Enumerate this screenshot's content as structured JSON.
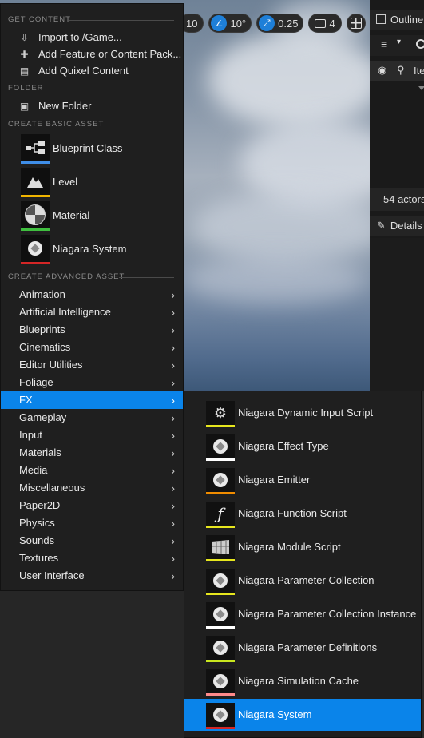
{
  "viewport_toolbar": {
    "grid_value": "10",
    "angle_value": "10°",
    "scale_value": "0.25",
    "camera_value": "4"
  },
  "outliner": {
    "title": "Outliner",
    "column_label": "Ite",
    "actors_count": "54 actors",
    "details_title": "Details"
  },
  "menu": {
    "get_content": {
      "header": "GET CONTENT",
      "items": [
        {
          "label": "Import to /Game...",
          "icon": "import-icon"
        },
        {
          "label": "Add Feature or Content Pack...",
          "icon": "add-feature-icon"
        },
        {
          "label": "Add Quixel Content",
          "icon": "quixel-icon"
        }
      ]
    },
    "folder": {
      "header": "FOLDER",
      "items": [
        {
          "label": "New Folder",
          "icon": "new-folder-icon"
        }
      ]
    },
    "basic_assets": {
      "header": "CREATE BASIC ASSET",
      "items": [
        {
          "label": "Blueprint Class",
          "color": "#3f8ee8",
          "icon": "blueprint-class-icon"
        },
        {
          "label": "Level",
          "color": "#f0b400",
          "icon": "level-icon"
        },
        {
          "label": "Material",
          "color": "#3fbf3f",
          "icon": "material-icon"
        },
        {
          "label": "Niagara System",
          "color": "#d42626",
          "icon": "niagara-system-icon"
        }
      ]
    },
    "advanced_assets": {
      "header": "CREATE ADVANCED ASSET",
      "items": [
        {
          "label": "Animation"
        },
        {
          "label": "Artificial Intelligence"
        },
        {
          "label": "Blueprints"
        },
        {
          "label": "Cinematics"
        },
        {
          "label": "Editor Utilities"
        },
        {
          "label": "Foliage"
        },
        {
          "label": "FX",
          "active": true
        },
        {
          "label": "Gameplay"
        },
        {
          "label": "Input"
        },
        {
          "label": "Materials"
        },
        {
          "label": "Media"
        },
        {
          "label": "Miscellaneous"
        },
        {
          "label": "Paper2D"
        },
        {
          "label": "Physics"
        },
        {
          "label": "Sounds"
        },
        {
          "label": "Textures"
        },
        {
          "label": "User Interface"
        }
      ]
    }
  },
  "fx_submenu": {
    "items": [
      {
        "label": "Niagara Dynamic Input Script",
        "color": "#e6e61e",
        "icon": "dynamic-input-script-icon"
      },
      {
        "label": "Niagara Effect Type",
        "color": "#ffffff",
        "icon": "effect-type-icon"
      },
      {
        "label": "Niagara Emitter",
        "color": "#f08c00",
        "icon": "emitter-icon"
      },
      {
        "label": "Niagara Function Script",
        "color": "#e6e61e",
        "icon": "function-script-icon"
      },
      {
        "label": "Niagara Module Script",
        "color": "#e6e61e",
        "icon": "module-script-icon"
      },
      {
        "label": "Niagara Parameter Collection",
        "color": "#e6e61e",
        "icon": "parameter-collection-icon"
      },
      {
        "label": "Niagara Parameter Collection Instance",
        "color": "#ffffff",
        "icon": "parameter-collection-instance-icon"
      },
      {
        "label": "Niagara Parameter Definitions",
        "color": "#c8e61e",
        "icon": "parameter-definitions-icon"
      },
      {
        "label": "Niagara Simulation Cache",
        "color": "#ff8a8a",
        "icon": "simulation-cache-icon"
      },
      {
        "label": "Niagara System",
        "color": "#d42626",
        "icon": "niagara-system-icon",
        "active": true
      }
    ]
  }
}
